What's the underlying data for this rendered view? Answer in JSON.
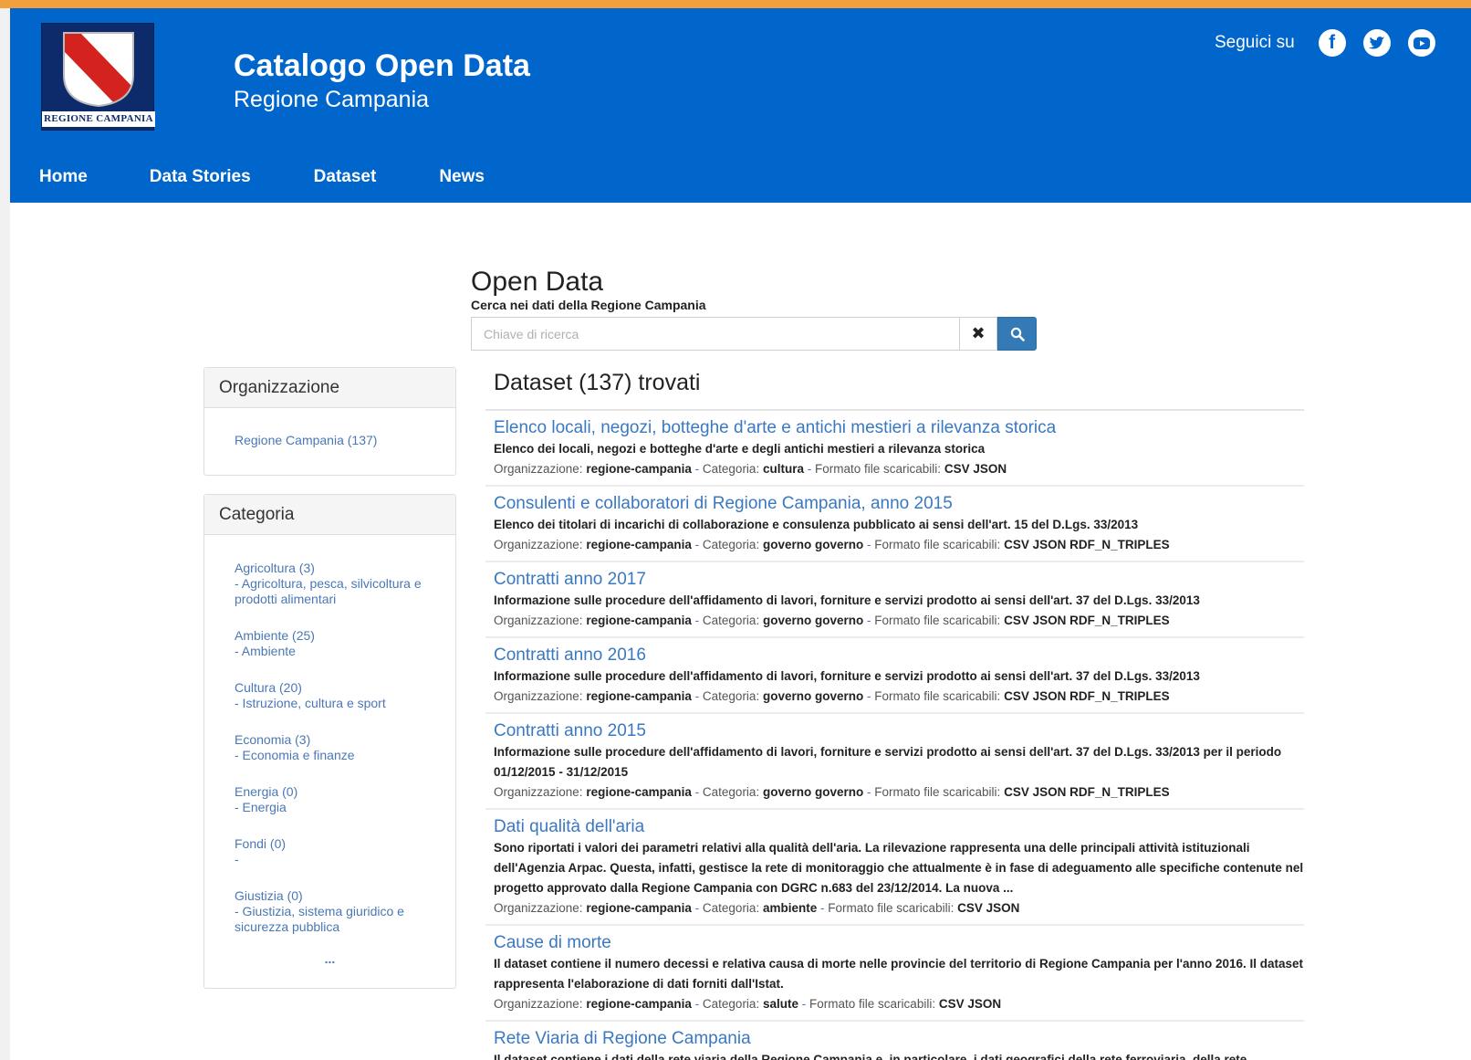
{
  "header": {
    "logo_text": "REGIONE CAMPANIA",
    "title": "Catalogo Open Data",
    "subtitle": "Regione Campania",
    "follow_label": "Seguici su"
  },
  "nav": [
    "Home",
    "Data Stories",
    "Dataset",
    "News"
  ],
  "search": {
    "title": "Open Data",
    "subtitle": "Cerca nei dati della Regione Campania",
    "placeholder": "Chiave di ricerca"
  },
  "org_panel": {
    "heading": "Organizzazione",
    "items": [
      "Regione Campania (137)"
    ]
  },
  "cat_panel": {
    "heading": "Categoria",
    "items": [
      {
        "label": "Agricoltura (3)",
        "sub": "- Agricoltura, pesca, silvicoltura e prodotti alimentari"
      },
      {
        "label": "Ambiente (25)",
        "sub": "- Ambiente"
      },
      {
        "label": "Cultura (20)",
        "sub": "- Istruzione, cultura e sport"
      },
      {
        "label": "Economia (3)",
        "sub": "- Economia e finanze"
      },
      {
        "label": "Energia (0)",
        "sub": "- Energia"
      },
      {
        "label": "Fondi (0)",
        "sub": "-"
      },
      {
        "label": "Giustizia (0)",
        "sub": "- Giustizia, sistema giuridico e sicurezza pubblica"
      }
    ],
    "more": "..."
  },
  "results": {
    "title": "Dataset (137) trovati",
    "org_label": "Organizzazione:",
    "cat_label": "Categoria:",
    "format_label": "Formato file scaricabili:",
    "items": [
      {
        "title": "Elenco locali, negozi, botteghe d'arte e antichi mestieri a rilevanza storica",
        "desc": "Elenco dei locali, negozi e botteghe d'arte e degli antichi mestieri a rilevanza storica",
        "org": "regione-campania",
        "cat": "cultura",
        "formats": "CSV JSON"
      },
      {
        "title": "Consulenti e collaboratori di Regione Campania, anno 2015",
        "desc": "Elenco dei titolari di incarichi di collaborazione e consulenza pubblicato ai sensi dell'art. 15 del D.Lgs. 33/2013",
        "org": "regione-campania",
        "cat": "governo governo",
        "formats": "CSV JSON RDF_N_TRIPLES"
      },
      {
        "title": "Contratti anno 2017",
        "desc": "Informazione sulle procedure dell'affidamento di lavori, forniture e servizi prodotto ai sensi dell'art. 37 del D.Lgs. 33/2013",
        "org": "regione-campania",
        "cat": "governo governo",
        "formats": "CSV JSON RDF_N_TRIPLES"
      },
      {
        "title": "Contratti anno 2016",
        "desc": "Informazione sulle procedure dell'affidamento di lavori, forniture e servizi prodotto ai sensi dell'art. 37 del D.Lgs. 33/2013",
        "org": "regione-campania",
        "cat": "governo governo",
        "formats": "CSV JSON RDF_N_TRIPLES"
      },
      {
        "title": "Contratti anno 2015",
        "desc": "Informazione sulle procedure dell'affidamento di lavori, forniture e servizi prodotto ai sensi dell'art. 37 del D.Lgs. 33/2013 per il periodo 01/12/2015 - 31/12/2015",
        "org": "regione-campania",
        "cat": "governo governo",
        "formats": "CSV JSON RDF_N_TRIPLES"
      },
      {
        "title": "Dati qualità dell'aria",
        "desc": "Sono riportati i valori dei parametri relativi alla qualità dell'aria. La rilevazione rappresenta una delle principali attività istituzionali dell'Agenzia Arpac. Questa, infatti, gestisce la rete di monitoraggio che attualmente è in fase di adeguamento alle specifiche contenute nel progetto approvato dalla Regione Campania con DGRC n.683 del 23/12/2014. La nuova ...",
        "org": "regione-campania",
        "cat": "ambiente",
        "formats": "CSV JSON"
      },
      {
        "title": "Cause di morte",
        "desc": "Il dataset contiene il numero decessi e relativa causa di morte nelle provincie del territorio di Regione Campania per l'anno 2016. Il dataset rappresenta l'elaborazione di dati forniti dall'Istat.",
        "org": "regione-campania",
        "cat": "salute",
        "formats": "CSV JSON"
      },
      {
        "title": "Rete Viaria di Regione Campania",
        "desc": "Il dataset contiene i dati della rete viaria della Regione Campania e, in particolare, i dati geografici della rete ferroviaria, della rete",
        "org": "",
        "cat": "",
        "formats": ""
      }
    ]
  }
}
